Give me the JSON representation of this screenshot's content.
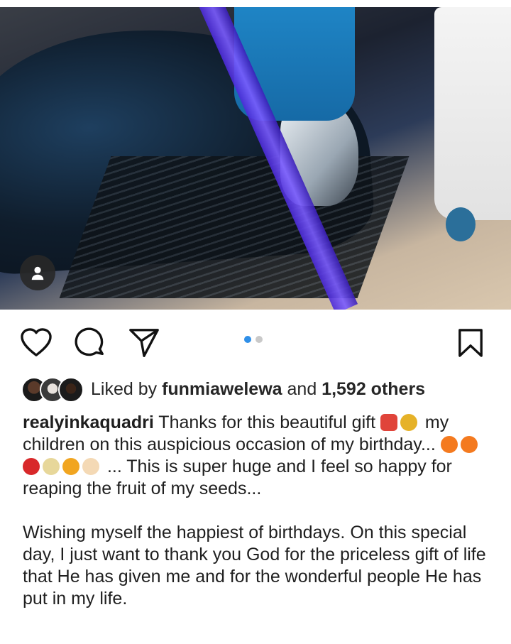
{
  "media": {
    "carousel_count": 2,
    "carousel_active": 1,
    "avatar_icon": "user-icon"
  },
  "actions": {
    "like_icon": "heart-icon",
    "comment_icon": "comment-icon",
    "share_icon": "send-icon",
    "save_icon": "bookmark-icon"
  },
  "likes": {
    "prefix": "Liked by ",
    "user": "funmiawelewa",
    "middle": " and ",
    "count": "1,592 others"
  },
  "caption": {
    "username": "realyinkaquadri",
    "p1_a": " Thanks for this beautiful gift ",
    "p1_b": " my children on this auspicious occasion of my birthday... ",
    "p1_c": " ... This is super huge and I feel so happy for reaping the fruit of my seeds...",
    "p2": "Wishing myself the happiest of birthdays. On this special day, I just want to thank you God for the priceless gift of life that He has given me and for the wonderful people He has put in my life."
  },
  "colors": {
    "accent_blue": "#2f8fe8",
    "text": "#262626"
  }
}
